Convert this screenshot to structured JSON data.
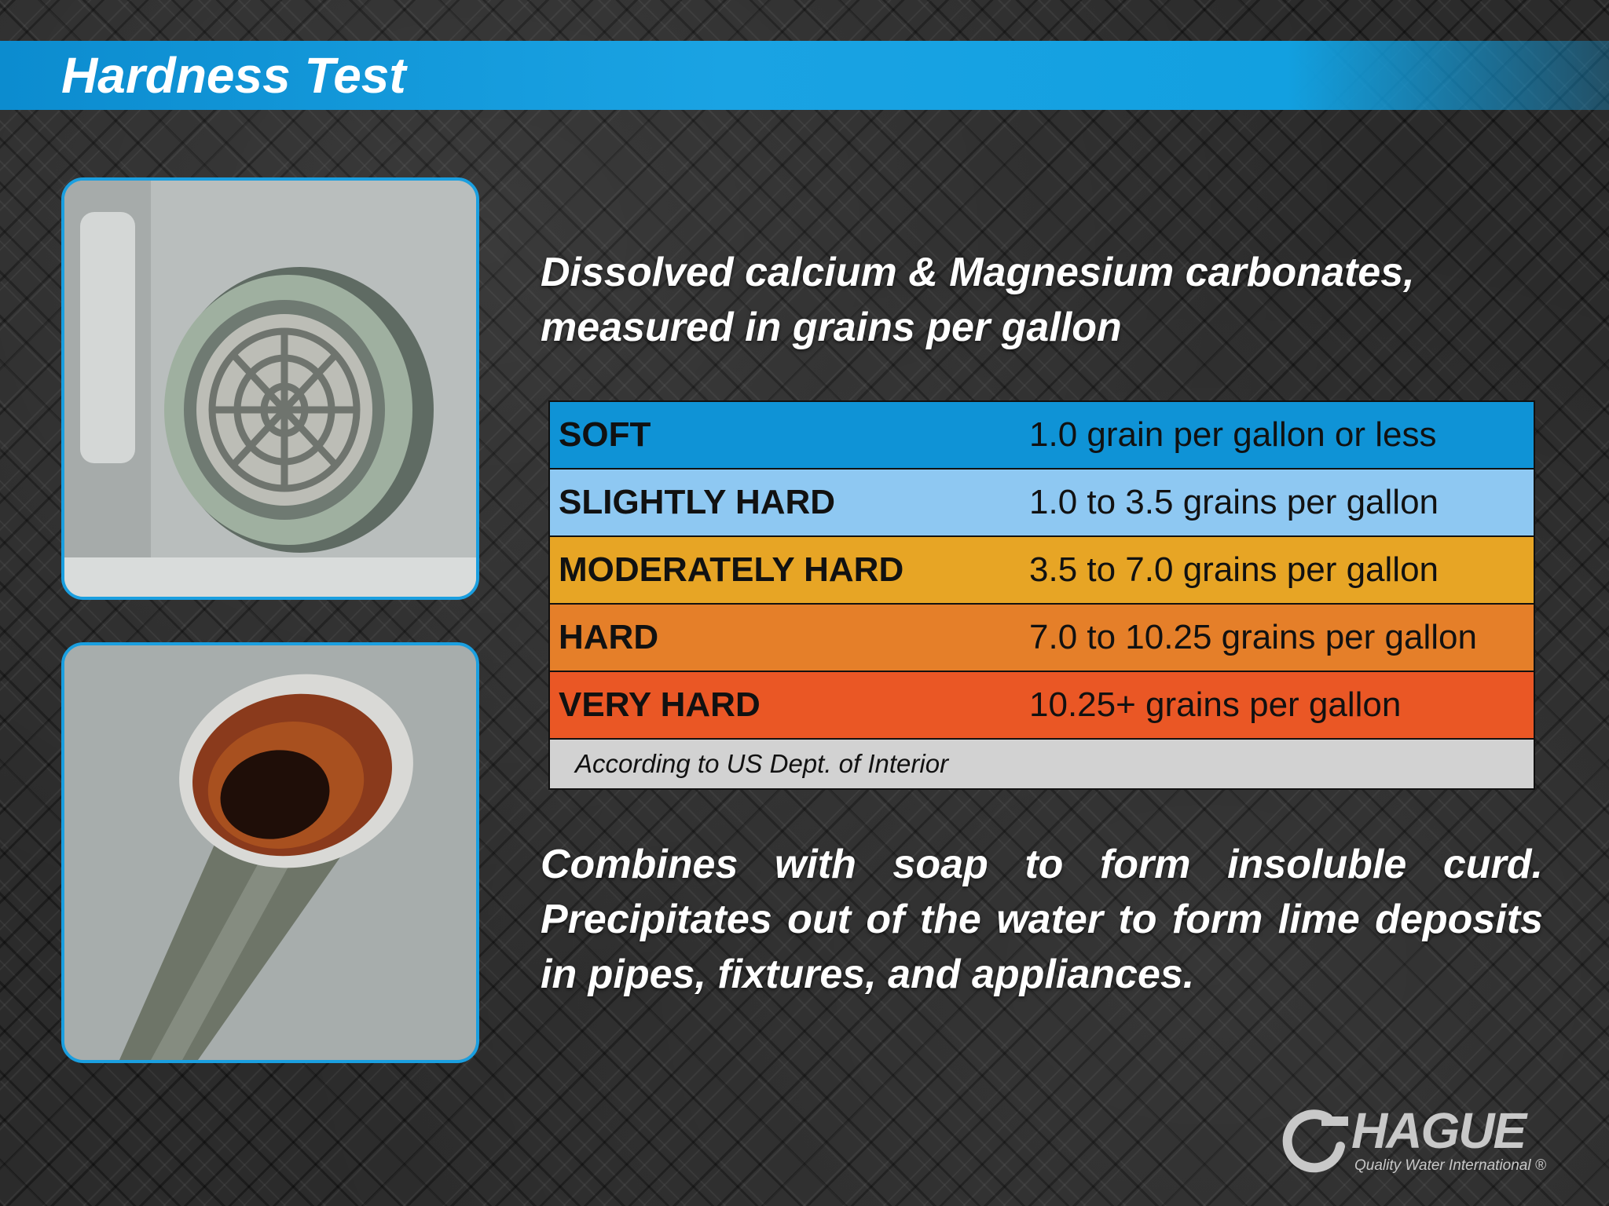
{
  "title": "Hardness Test",
  "intro": "Dissolved calcium & Magnesium carbonates, measured in grains per gallon",
  "table": {
    "rows": [
      {
        "label": "SOFT",
        "value": "1.0 grain per gallon or less",
        "color": "#0f93d6"
      },
      {
        "label": "SLIGHTLY HARD",
        "value": "1.0 to 3.5 grains per gallon",
        "color": "#8ec8f2"
      },
      {
        "label": "MODERATELY HARD",
        "value": "3.5 to 7.0 grains per gallon",
        "color": "#e7a525"
      },
      {
        "label": "HARD",
        "value": "7.0 to 10.25 grains per gallon",
        "color": "#e57f29"
      },
      {
        "label": "VERY HARD",
        "value": "10.25+ grains per gallon",
        "color": "#ea5725"
      }
    ],
    "source": "According to US Dept. of Interior"
  },
  "effects": "Combines with soap to form insoluble curd. Precipitates out of the water to form lime deposits in pipes, fixtures, and appliances.",
  "logo": {
    "name": "HAGUE",
    "tagline": "Quality Water International ®"
  },
  "images": {
    "top": "scaled-faucet-aerator-photo",
    "bottom": "corroded-pipe-photo"
  }
}
